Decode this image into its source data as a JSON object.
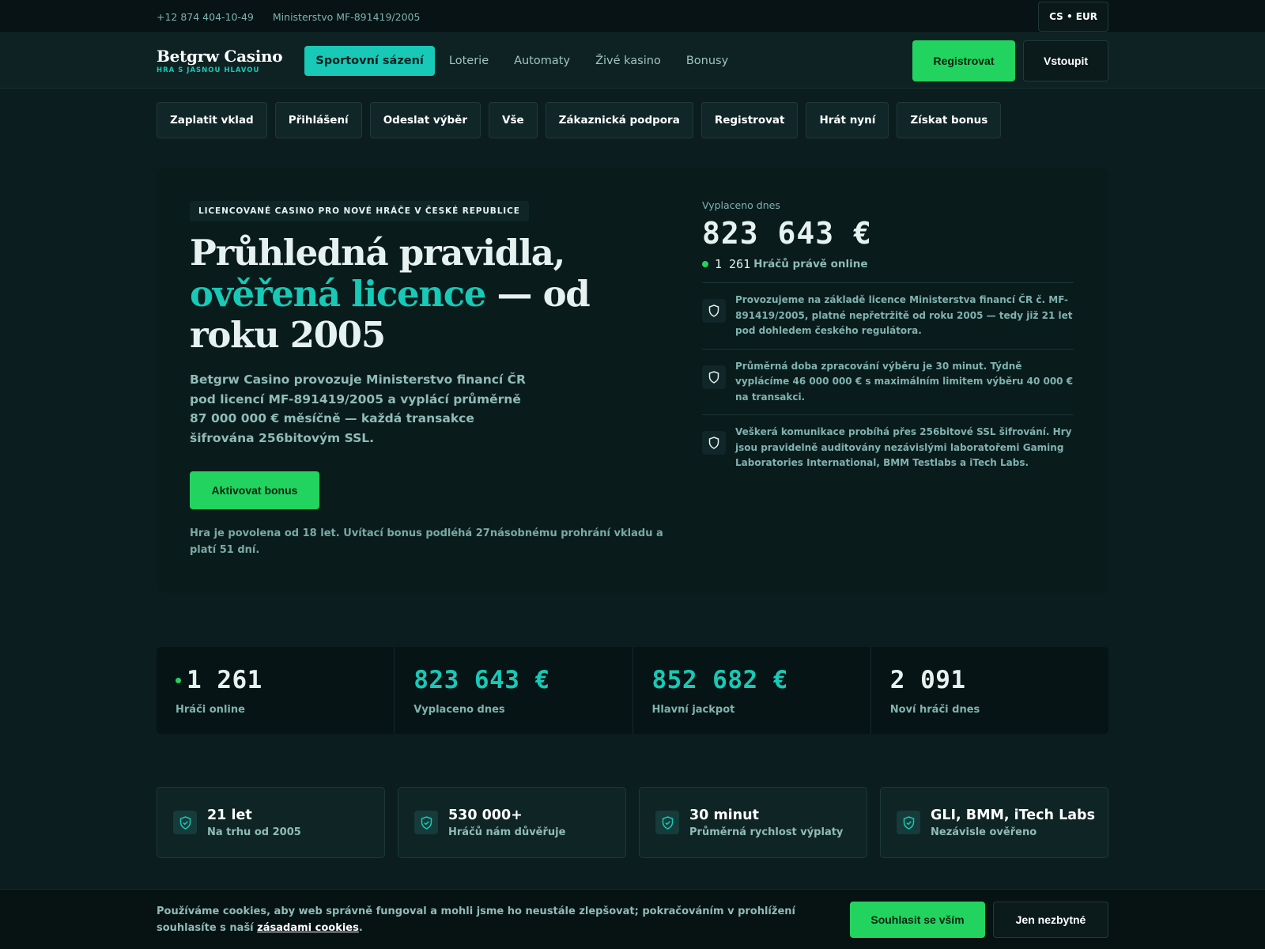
{
  "topbar": {
    "phone": "+12 874 404-10-49",
    "license": "Ministerstvo MF-891419/2005",
    "lang_currency": "CS • EUR"
  },
  "header": {
    "brand_name": "Betgrw Casino",
    "brand_tagline": "HRA S JASNOU HLAVOU",
    "nav": [
      "Sportovní sázení",
      "Loterie",
      "Automaty",
      "Živé kasino",
      "Bonusy"
    ],
    "register": "Registrovat",
    "login": "Vstoupit"
  },
  "quick_links": [
    "Zaplatit vklad",
    "Přihlášení",
    "Odeslat výběr",
    "Vše",
    "Zákaznická podpora",
    "Registrovat",
    "Hrát nyní",
    "Získat bonus"
  ],
  "hero": {
    "eyebrow": "LICENCOVANÉ CASINO PRO NOVÉ HRÁČE V ČESKÉ REPUBLICE",
    "headline_1": "Průhledná pravidla,",
    "headline_accent": "ověřená licence",
    "headline_2": " — od roku 2005",
    "lead": "Betgrw Casino provozuje Ministerstvo financí ČR pod licencí MF-891419/2005 a vyplácí průměrně 87 000 000 € měsíčně — každá transakce šifrována 256bitovým SSL.",
    "cta": "Aktivovat bonus",
    "fine_print": "Hra je povolena od 18 let. Uvítací bonus podléhá 27násobnému prohrání vkladu a platí 51 dní.",
    "paid_label": "Vyplaceno dnes",
    "paid_value": "823 643 €",
    "online_count": "1 261",
    "online_label": "Hráčů právě online",
    "facts": [
      "Provozujeme na základě licence Ministerstva financí ČR č. MF-891419/2005, platné nepřetržitě od roku 2005 — tedy již 21 let pod dohledem českého regulátora.",
      "Průměrná doba zpracování výběru je 30 minut. Týdně vyplácíme 46 000 000 € s maximálním limitem výběru 40 000 € na transakci.",
      "Veškerá komunikace probíhá přes 256bitové SSL šifrování. Hry jsou pravidelně auditovány nezávislými laboratořemi Gaming Laboratories International, BMM Testlabs a iTech Labs."
    ]
  },
  "stats": [
    {
      "value": "1 261",
      "label": "Hráči online"
    },
    {
      "value": "823 643 €",
      "label": "Vyplaceno dnes"
    },
    {
      "value": "852 682 €",
      "label": "Hlavní jackpot"
    },
    {
      "value": "2 091",
      "label": "Noví hráči dnes"
    }
  ],
  "trust": [
    {
      "title": "21 let",
      "sub": "Na trhu od 2005"
    },
    {
      "title": "530 000+",
      "sub": "Hráčů nám důvěřuje"
    },
    {
      "title": "30 minut",
      "sub": "Průměrná rychlost výplaty"
    },
    {
      "title": "GLI, BMM, iTech Labs",
      "sub": "Nezávisle ověřeno"
    }
  ],
  "cookie": {
    "message": "Používáme cookies, aby web správně fungoval a mohli jsme ho neustále zlepšovat; pokračováním v prohlížení souhlasíte s naší ",
    "link": "zásadami cookies",
    "tail": ".",
    "accept": "Souhlasit se vším",
    "essential": "Jen nezbytné"
  },
  "colors": {
    "accent_teal": "#17c9b6",
    "accent_green": "#22d35f",
    "background": "#0b1d1e"
  },
  "icons": {
    "fact_icon": "shield-icon",
    "trust_icon": "shield-check-icon",
    "online_indicator": "status-dot"
  }
}
